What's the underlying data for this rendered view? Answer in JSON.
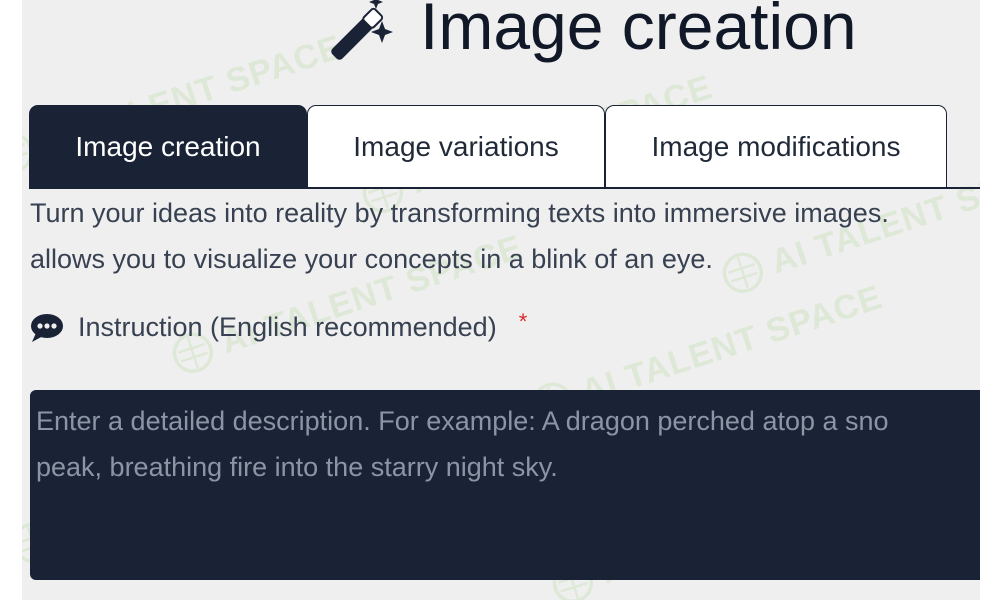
{
  "header": {
    "title": "Image creation",
    "icon": "magic-wand-icon"
  },
  "tabs": [
    {
      "label": "Image creation",
      "active": true
    },
    {
      "label": "Image variations",
      "active": false
    },
    {
      "label": "Image modifications",
      "active": false
    }
  ],
  "description": {
    "line1": "Turn your ideas into reality by transforming texts into immersive images.",
    "line2": "allows you to visualize your concepts in a blink of an eye."
  },
  "instruction": {
    "icon": "chat-bubble-icon",
    "label": "Instruction (English recommended)",
    "required_marker": "*",
    "placeholder_line1": "Enter a detailed description. For example: A dragon perched atop a sno",
    "placeholder_line2": "peak, breathing fire into the starry night sky."
  },
  "watermark": {
    "text": "AI TALENT SPACE"
  },
  "colors": {
    "dark": "#1a2335",
    "panel_bg": "#efefef",
    "required": "#dc2626",
    "placeholder": "#8c95a6",
    "watermark": "#a0d282"
  }
}
